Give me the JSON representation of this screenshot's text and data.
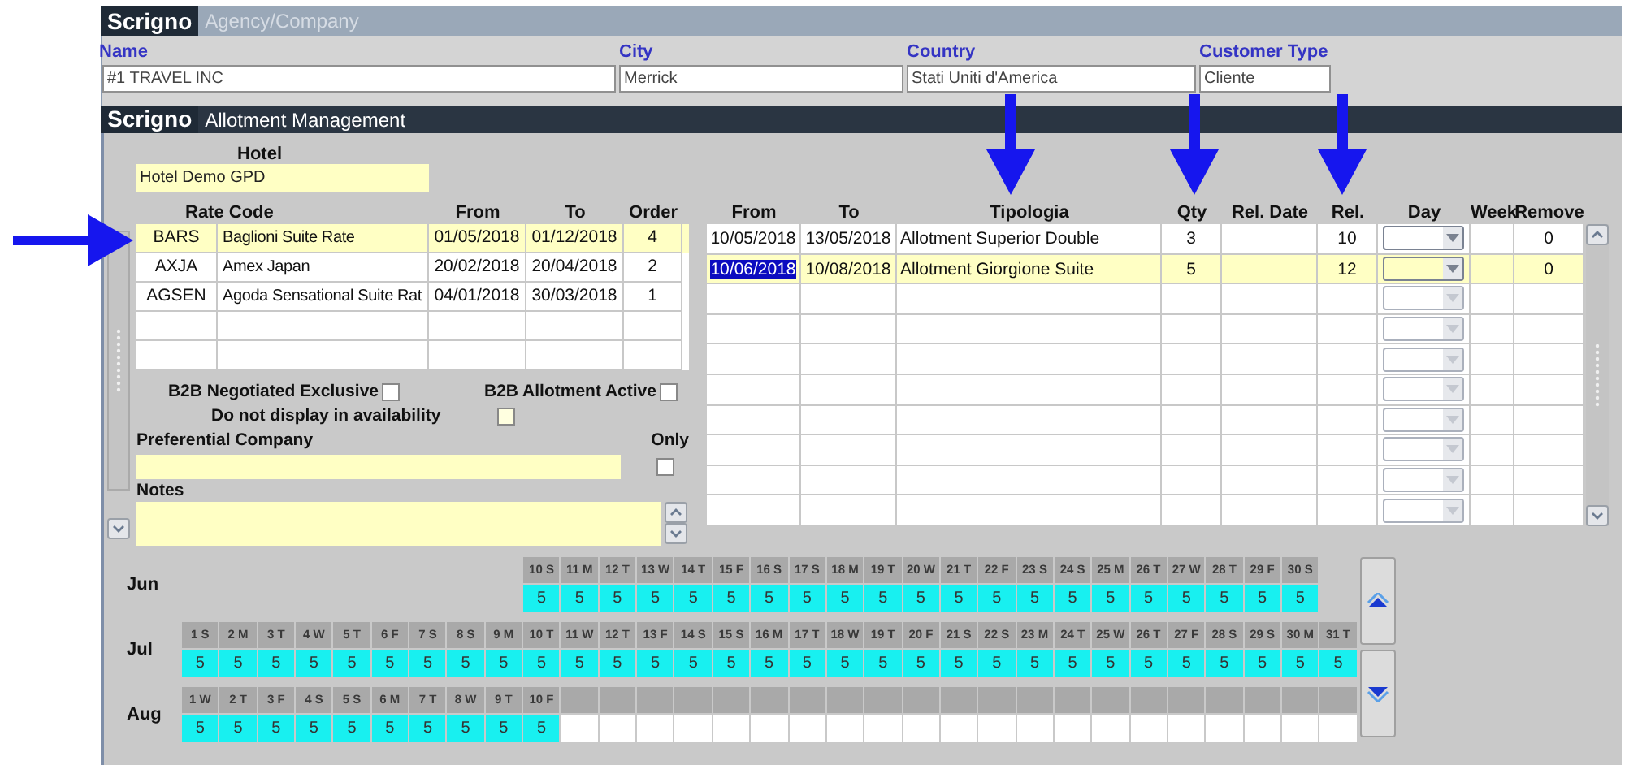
{
  "agency_panel": {
    "logo": "Scrigno",
    "title": "Agency/Company",
    "fields": [
      {
        "label": "Name",
        "value": "#1 TRAVEL INC"
      },
      {
        "label": "City",
        "value": "Merrick"
      },
      {
        "label": "Country",
        "value": "Stati Uniti d'America"
      },
      {
        "label": "Customer Type",
        "value": "Cliente"
      }
    ]
  },
  "allotment_panel": {
    "logo": "Scrigno",
    "title": "Allotment Management"
  },
  "hotel": {
    "label": "Hotel",
    "value": "Hotel Demo GPD"
  },
  "rate_table": {
    "columns": [
      "Rate Code",
      "From",
      "To",
      "Order"
    ],
    "rows": [
      {
        "code": "BARS",
        "name": "Baglioni Suite Rate",
        "from": "01/05/2018",
        "to": "01/12/2018",
        "order": "4",
        "selected": true
      },
      {
        "code": "AXJA",
        "name": "Amex Japan",
        "from": "20/02/2018",
        "to": "20/04/2018",
        "order": "2",
        "selected": false
      },
      {
        "code": "AGSEN",
        "name": "Agoda Sensational Suite Rat",
        "from": "04/01/2018",
        "to": "30/03/2018",
        "order": "1",
        "selected": false
      },
      {
        "selected": false
      },
      {
        "selected": false
      }
    ]
  },
  "options": [
    {
      "label": "B2B Negotiated Exclusive",
      "checked": false
    },
    {
      "label": "B2B Allotment Active",
      "checked": false
    },
    {
      "label": "Do not display in availability",
      "checked": false
    }
  ],
  "preferential": {
    "label": "Preferential Company",
    "only_label": "Only",
    "only_checked": false
  },
  "notes": {
    "label": "Notes"
  },
  "allotments": {
    "columns": [
      "From",
      "To",
      "Tipologia",
      "Qty",
      "Rel. Date",
      "Rel.",
      "Day",
      "Week",
      "Remove"
    ],
    "rows": [
      {
        "from": "10/05/2018",
        "to": "13/05/2018",
        "tipologia": "Allotment Superior Double",
        "qty": "3",
        "rel": "10",
        "remove": "0",
        "selected": false,
        "from_selected": false,
        "day_disabled": false
      },
      {
        "from": "10/06/2018",
        "to": "10/08/2018",
        "tipologia": "Allotment Giorgione Suite",
        "qty": "5",
        "rel": "12",
        "remove": "0",
        "selected": true,
        "from_selected": true,
        "day_disabled": false
      },
      {
        "selected": false,
        "day_disabled": true
      },
      {
        "selected": false,
        "day_disabled": true
      },
      {
        "selected": false,
        "day_disabled": true
      },
      {
        "selected": false,
        "day_disabled": true
      },
      {
        "selected": false,
        "day_disabled": true
      },
      {
        "selected": false,
        "day_disabled": true
      },
      {
        "selected": false,
        "day_disabled": true
      },
      {
        "selected": false,
        "day_disabled": true
      }
    ]
  },
  "calendar": {
    "months": [
      {
        "name": "Jun",
        "cells": [
          {
            "kind": "gap"
          },
          {
            "kind": "gap"
          },
          {
            "kind": "gap"
          },
          {
            "kind": "gap"
          },
          {
            "kind": "gap"
          },
          {
            "kind": "gap"
          },
          {
            "kind": "gap"
          },
          {
            "kind": "gap"
          },
          {
            "kind": "gap"
          },
          {
            "kind": "day",
            "label": "10 S",
            "value": "5"
          },
          {
            "kind": "day",
            "label": "11 M",
            "value": "5"
          },
          {
            "kind": "day",
            "label": "12 T",
            "value": "5"
          },
          {
            "kind": "day",
            "label": "13 W",
            "value": "5"
          },
          {
            "kind": "day",
            "label": "14 T",
            "value": "5"
          },
          {
            "kind": "day",
            "label": "15 F",
            "value": "5"
          },
          {
            "kind": "day",
            "label": "16 S",
            "value": "5"
          },
          {
            "kind": "day",
            "label": "17 S",
            "value": "5"
          },
          {
            "kind": "day",
            "label": "18 M",
            "value": "5"
          },
          {
            "kind": "day",
            "label": "19 T",
            "value": "5"
          },
          {
            "kind": "day",
            "label": "20 W",
            "value": "5"
          },
          {
            "kind": "day",
            "label": "21 T",
            "value": "5"
          },
          {
            "kind": "day",
            "label": "22 F",
            "value": "5"
          },
          {
            "kind": "day",
            "label": "23 S",
            "value": "5"
          },
          {
            "kind": "day",
            "label": "24 S",
            "value": "5"
          },
          {
            "kind": "day",
            "label": "25 M",
            "value": "5"
          },
          {
            "kind": "day",
            "label": "26 T",
            "value": "5"
          },
          {
            "kind": "day",
            "label": "27 W",
            "value": "5"
          },
          {
            "kind": "day",
            "label": "28 T",
            "value": "5"
          },
          {
            "kind": "day",
            "label": "29 F",
            "value": "5"
          },
          {
            "kind": "day",
            "label": "30 S",
            "value": "5"
          }
        ]
      },
      {
        "name": "Jul",
        "cells": [
          {
            "kind": "day",
            "label": "1 S",
            "value": "5"
          },
          {
            "kind": "day",
            "label": "2 M",
            "value": "5"
          },
          {
            "kind": "day",
            "label": "3 T",
            "value": "5"
          },
          {
            "kind": "day",
            "label": "4 W",
            "value": "5"
          },
          {
            "kind": "day",
            "label": "5 T",
            "value": "5"
          },
          {
            "kind": "day",
            "label": "6 F",
            "value": "5"
          },
          {
            "kind": "day",
            "label": "7 S",
            "value": "5"
          },
          {
            "kind": "day",
            "label": "8 S",
            "value": "5"
          },
          {
            "kind": "day",
            "label": "9 M",
            "value": "5"
          },
          {
            "kind": "day",
            "label": "10 T",
            "value": "5"
          },
          {
            "kind": "day",
            "label": "11 W",
            "value": "5"
          },
          {
            "kind": "day",
            "label": "12 T",
            "value": "5"
          },
          {
            "kind": "day",
            "label": "13 F",
            "value": "5"
          },
          {
            "kind": "day",
            "label": "14 S",
            "value": "5"
          },
          {
            "kind": "day",
            "label": "15 S",
            "value": "5"
          },
          {
            "kind": "day",
            "label": "16 M",
            "value": "5"
          },
          {
            "kind": "day",
            "label": "17 T",
            "value": "5"
          },
          {
            "kind": "day",
            "label": "18 W",
            "value": "5"
          },
          {
            "kind": "day",
            "label": "19 T",
            "value": "5"
          },
          {
            "kind": "day",
            "label": "20 F",
            "value": "5"
          },
          {
            "kind": "day",
            "label": "21 S",
            "value": "5"
          },
          {
            "kind": "day",
            "label": "22 S",
            "value": "5"
          },
          {
            "kind": "day",
            "label": "23 M",
            "value": "5"
          },
          {
            "kind": "day",
            "label": "24 T",
            "value": "5"
          },
          {
            "kind": "day",
            "label": "25 W",
            "value": "5"
          },
          {
            "kind": "day",
            "label": "26 T",
            "value": "5"
          },
          {
            "kind": "day",
            "label": "27 F",
            "value": "5"
          },
          {
            "kind": "day",
            "label": "28 S",
            "value": "5"
          },
          {
            "kind": "day",
            "label": "29 S",
            "value": "5"
          },
          {
            "kind": "day",
            "label": "30 M",
            "value": "5"
          },
          {
            "kind": "day",
            "label": "31 T",
            "value": "5"
          }
        ]
      },
      {
        "name": "Aug",
        "cells": [
          {
            "kind": "day",
            "label": "1 W",
            "value": "5"
          },
          {
            "kind": "day",
            "label": "2 T",
            "value": "5"
          },
          {
            "kind": "day",
            "label": "3 F",
            "value": "5"
          },
          {
            "kind": "day",
            "label": "4 S",
            "value": "5"
          },
          {
            "kind": "day",
            "label": "5 S",
            "value": "5"
          },
          {
            "kind": "day",
            "label": "6 M",
            "value": "5"
          },
          {
            "kind": "day",
            "label": "7 T",
            "value": "5"
          },
          {
            "kind": "day",
            "label": "8 W",
            "value": "5"
          },
          {
            "kind": "day",
            "label": "9 T",
            "value": "5"
          },
          {
            "kind": "day",
            "label": "10 F",
            "value": "5"
          },
          {
            "kind": "empty"
          },
          {
            "kind": "empty"
          },
          {
            "kind": "empty"
          },
          {
            "kind": "empty"
          },
          {
            "kind": "empty"
          },
          {
            "kind": "empty"
          },
          {
            "kind": "empty"
          },
          {
            "kind": "empty"
          },
          {
            "kind": "empty"
          },
          {
            "kind": "empty"
          },
          {
            "kind": "empty"
          },
          {
            "kind": "empty"
          },
          {
            "kind": "empty"
          },
          {
            "kind": "empty"
          },
          {
            "kind": "empty"
          },
          {
            "kind": "empty"
          },
          {
            "kind": "empty"
          },
          {
            "kind": "empty"
          },
          {
            "kind": "empty"
          },
          {
            "kind": "empty"
          },
          {
            "kind": "empty"
          }
        ]
      }
    ]
  },
  "annotations": [
    {
      "kind": "arrow-right"
    },
    {
      "kind": "arrow-down"
    },
    {
      "kind": "arrow-down"
    },
    {
      "kind": "arrow-down"
    }
  ]
}
